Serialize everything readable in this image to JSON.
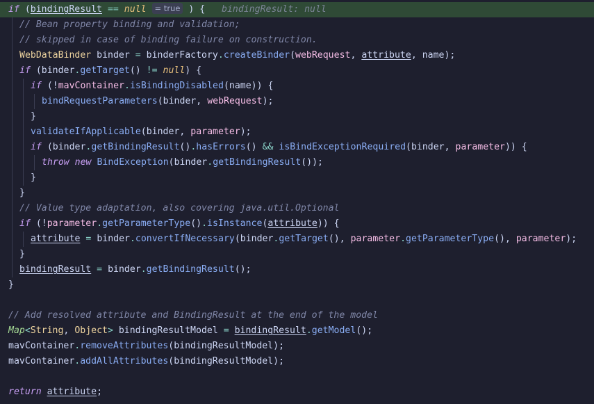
{
  "editor": {
    "lines": [
      {
        "indent": 0,
        "hl": true,
        "tokens": [
          {
            "t": "if",
            "c": "kw"
          },
          {
            "t": " ("
          },
          {
            "t": "bindingResult",
            "c": "var ul"
          },
          {
            "t": " "
          },
          {
            "t": "==",
            "c": "op"
          },
          {
            "t": " "
          },
          {
            "t": "null",
            "c": "null"
          },
          {
            "t": " "
          },
          {
            "t": "= true",
            "c": "inlay"
          },
          {
            "t": " ) {"
          },
          {
            "t": "   bindingResult: null",
            "c": "hint"
          }
        ]
      },
      {
        "indent": 1,
        "tokens": [
          {
            "t": "// Bean property binding and validation;",
            "c": "cm"
          }
        ]
      },
      {
        "indent": 1,
        "tokens": [
          {
            "t": "// skipped in case of binding failure on construction.",
            "c": "cm"
          }
        ]
      },
      {
        "indent": 1,
        "tokens": [
          {
            "t": "WebDataBinder",
            "c": "typ"
          },
          {
            "t": " binder "
          },
          {
            "t": "=",
            "c": "op"
          },
          {
            "t": " binderFactory"
          },
          {
            "t": ".",
            "c": "op"
          },
          {
            "t": "createBinder",
            "c": "fn"
          },
          {
            "t": "("
          },
          {
            "t": "webRequest",
            "c": "param"
          },
          {
            "t": ", "
          },
          {
            "t": "attribute",
            "c": "var ul"
          },
          {
            "t": ", name);"
          }
        ]
      },
      {
        "indent": 1,
        "tokens": [
          {
            "t": "if",
            "c": "kw"
          },
          {
            "t": " (binder"
          },
          {
            "t": ".",
            "c": "op"
          },
          {
            "t": "getTarget",
            "c": "fn"
          },
          {
            "t": "() "
          },
          {
            "t": "!=",
            "c": "op"
          },
          {
            "t": " "
          },
          {
            "t": "null",
            "c": "null"
          },
          {
            "t": ") {"
          }
        ]
      },
      {
        "indent": 2,
        "tokens": [
          {
            "t": "if",
            "c": "kw"
          },
          {
            "t": " (!"
          },
          {
            "t": "mavContainer",
            "c": "param"
          },
          {
            "t": ".",
            "c": "op"
          },
          {
            "t": "isBindingDisabled",
            "c": "fn"
          },
          {
            "t": "(name)) {"
          }
        ]
      },
      {
        "indent": 3,
        "tokens": [
          {
            "t": "bindRequestParameters",
            "c": "fn"
          },
          {
            "t": "(binder, "
          },
          {
            "t": "webRequest",
            "c": "param"
          },
          {
            "t": ");"
          }
        ]
      },
      {
        "indent": 2,
        "tokens": [
          {
            "t": "}"
          }
        ]
      },
      {
        "indent": 2,
        "tokens": [
          {
            "t": "validateIfApplicable",
            "c": "fn"
          },
          {
            "t": "(binder, "
          },
          {
            "t": "parameter",
            "c": "param"
          },
          {
            "t": ");"
          }
        ]
      },
      {
        "indent": 2,
        "tokens": [
          {
            "t": "if",
            "c": "kw"
          },
          {
            "t": " (binder"
          },
          {
            "t": ".",
            "c": "op"
          },
          {
            "t": "getBindingResult",
            "c": "fn"
          },
          {
            "t": "()"
          },
          {
            "t": ".",
            "c": "op"
          },
          {
            "t": "hasErrors",
            "c": "fn"
          },
          {
            "t": "() "
          },
          {
            "t": "&&",
            "c": "op"
          },
          {
            "t": " "
          },
          {
            "t": "isBindExceptionRequired",
            "c": "fn"
          },
          {
            "t": "(binder, "
          },
          {
            "t": "parameter",
            "c": "param"
          },
          {
            "t": ")) {"
          }
        ]
      },
      {
        "indent": 3,
        "tokens": [
          {
            "t": "throw",
            "c": "kw"
          },
          {
            "t": " "
          },
          {
            "t": "new",
            "c": "kw"
          },
          {
            "t": " "
          },
          {
            "t": "BindException",
            "c": "fn"
          },
          {
            "t": "(binder"
          },
          {
            "t": ".",
            "c": "op"
          },
          {
            "t": "getBindingResult",
            "c": "fn"
          },
          {
            "t": "());"
          }
        ]
      },
      {
        "indent": 2,
        "tokens": [
          {
            "t": "}"
          }
        ]
      },
      {
        "indent": 1,
        "tokens": [
          {
            "t": "}"
          }
        ]
      },
      {
        "indent": 1,
        "tokens": [
          {
            "t": "// Value type adaptation, also covering java.util.Optional",
            "c": "cm"
          }
        ]
      },
      {
        "indent": 1,
        "tokens": [
          {
            "t": "if",
            "c": "kw"
          },
          {
            "t": " (!"
          },
          {
            "t": "parameter",
            "c": "param"
          },
          {
            "t": ".",
            "c": "op"
          },
          {
            "t": "getParameterType",
            "c": "fn"
          },
          {
            "t": "()"
          },
          {
            "t": ".",
            "c": "op"
          },
          {
            "t": "isInstance",
            "c": "fn"
          },
          {
            "t": "("
          },
          {
            "t": "attribute",
            "c": "var ul"
          },
          {
            "t": ")) {"
          }
        ]
      },
      {
        "indent": 2,
        "tokens": [
          {
            "t": "attribute",
            "c": "var ul"
          },
          {
            "t": " "
          },
          {
            "t": "=",
            "c": "op"
          },
          {
            "t": " binder"
          },
          {
            "t": ".",
            "c": "op"
          },
          {
            "t": "convertIfNecessary",
            "c": "fn"
          },
          {
            "t": "(binder"
          },
          {
            "t": ".",
            "c": "op"
          },
          {
            "t": "getTarget",
            "c": "fn"
          },
          {
            "t": "(), "
          },
          {
            "t": "parameter",
            "c": "param"
          },
          {
            "t": ".",
            "c": "op"
          },
          {
            "t": "getParameterType",
            "c": "fn"
          },
          {
            "t": "(), "
          },
          {
            "t": "parameter",
            "c": "param"
          },
          {
            "t": ");"
          }
        ]
      },
      {
        "indent": 1,
        "tokens": [
          {
            "t": "}"
          }
        ]
      },
      {
        "indent": 1,
        "tokens": [
          {
            "t": "bindingResult",
            "c": "var ul"
          },
          {
            "t": " "
          },
          {
            "t": "=",
            "c": "op"
          },
          {
            "t": " binder"
          },
          {
            "t": ".",
            "c": "op"
          },
          {
            "t": "getBindingResult",
            "c": "fn"
          },
          {
            "t": "();"
          }
        ]
      },
      {
        "indent": 0,
        "tokens": [
          {
            "t": "}"
          }
        ]
      },
      {
        "indent": 0,
        "tokens": []
      },
      {
        "indent": 0,
        "tokens": [
          {
            "t": "// Add resolved attribute and BindingResult at the end of the model",
            "c": "cm"
          }
        ]
      },
      {
        "indent": 0,
        "tokens": [
          {
            "t": "Map",
            "c": "iface"
          },
          {
            "t": "<",
            "c": "op"
          },
          {
            "t": "String",
            "c": "typ"
          },
          {
            "t": ", "
          },
          {
            "t": "Object",
            "c": "typ"
          },
          {
            "t": ">",
            "c": "op"
          },
          {
            "t": " bindingResultModel "
          },
          {
            "t": "=",
            "c": "op"
          },
          {
            "t": " "
          },
          {
            "t": "bindingResult",
            "c": "var ul"
          },
          {
            "t": ".",
            "c": "op"
          },
          {
            "t": "getModel",
            "c": "fn"
          },
          {
            "t": "();"
          }
        ]
      },
      {
        "indent": 0,
        "tokens": [
          {
            "t": "mavContainer"
          },
          {
            "t": ".",
            "c": "op"
          },
          {
            "t": "removeAttributes",
            "c": "fn"
          },
          {
            "t": "(bindingResultModel);"
          }
        ]
      },
      {
        "indent": 0,
        "tokens": [
          {
            "t": "mavContainer"
          },
          {
            "t": ".",
            "c": "op"
          },
          {
            "t": "addAllAttributes",
            "c": "fn"
          },
          {
            "t": "(bindingResultModel);"
          }
        ]
      },
      {
        "indent": 0,
        "tokens": []
      },
      {
        "indent": 0,
        "tokens": [
          {
            "t": "return",
            "c": "kw"
          },
          {
            "t": " "
          },
          {
            "t": "attribute",
            "c": "var ul"
          },
          {
            "t": ";"
          }
        ]
      }
    ]
  }
}
